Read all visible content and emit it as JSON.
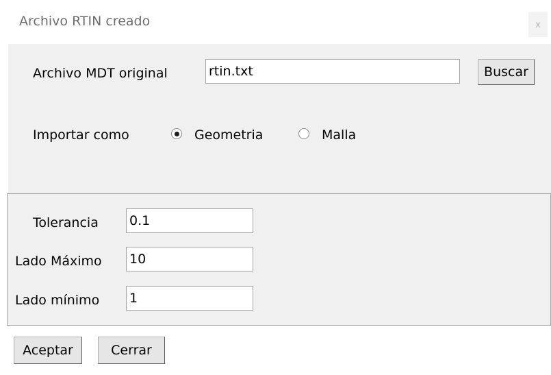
{
  "window": {
    "title": "Archivo RTIN creado",
    "close_glyph": "x"
  },
  "file": {
    "label": "Archivo MDT original",
    "value": "rtin.txt",
    "browse_label": "Buscar"
  },
  "import_as": {
    "label": "Importar como",
    "options": [
      {
        "label": "Geometria",
        "selected": true
      },
      {
        "label": "Malla",
        "selected": false
      }
    ]
  },
  "params": {
    "tolerance": {
      "label": "Tolerancia",
      "value": "0.1"
    },
    "max_side": {
      "label": "Lado Máximo",
      "value": "10"
    },
    "min_side": {
      "label": "Lado mínimo",
      "value": "1"
    }
  },
  "actions": {
    "accept_label": "Aceptar",
    "close_label": "Cerrar"
  }
}
